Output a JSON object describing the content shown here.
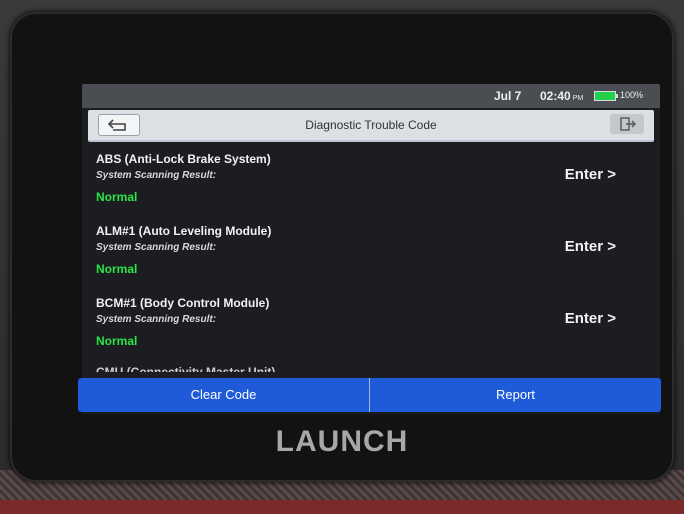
{
  "status_bar": {
    "date": "Jul 7",
    "time": "02:40",
    "ampm": "PM",
    "battery": "100%"
  },
  "header": {
    "title": "Diagnostic Trouble Code"
  },
  "systems": [
    {
      "name": "ABS (Anti-Lock Brake System)",
      "label": "System Scanning Result:",
      "status": "Normal",
      "action": "Enter >"
    },
    {
      "name": "ALM#1 (Auto Leveling Module)",
      "label": "System Scanning Result:",
      "status": "Normal",
      "action": "Enter >"
    },
    {
      "name": "BCM#1 (Body Control Module)",
      "label": "System Scanning Result:",
      "status": "Normal",
      "action": "Enter >"
    }
  ],
  "partial_item": "CMU (Connectivity Master Unit)",
  "footer": {
    "clear_code": "Clear Code",
    "report": "Report"
  },
  "brand": "LAUNCH",
  "colors": {
    "status_normal": "#2ee34a",
    "footer_blue": "#1f5bd9",
    "battery_green": "#1fd14a"
  }
}
